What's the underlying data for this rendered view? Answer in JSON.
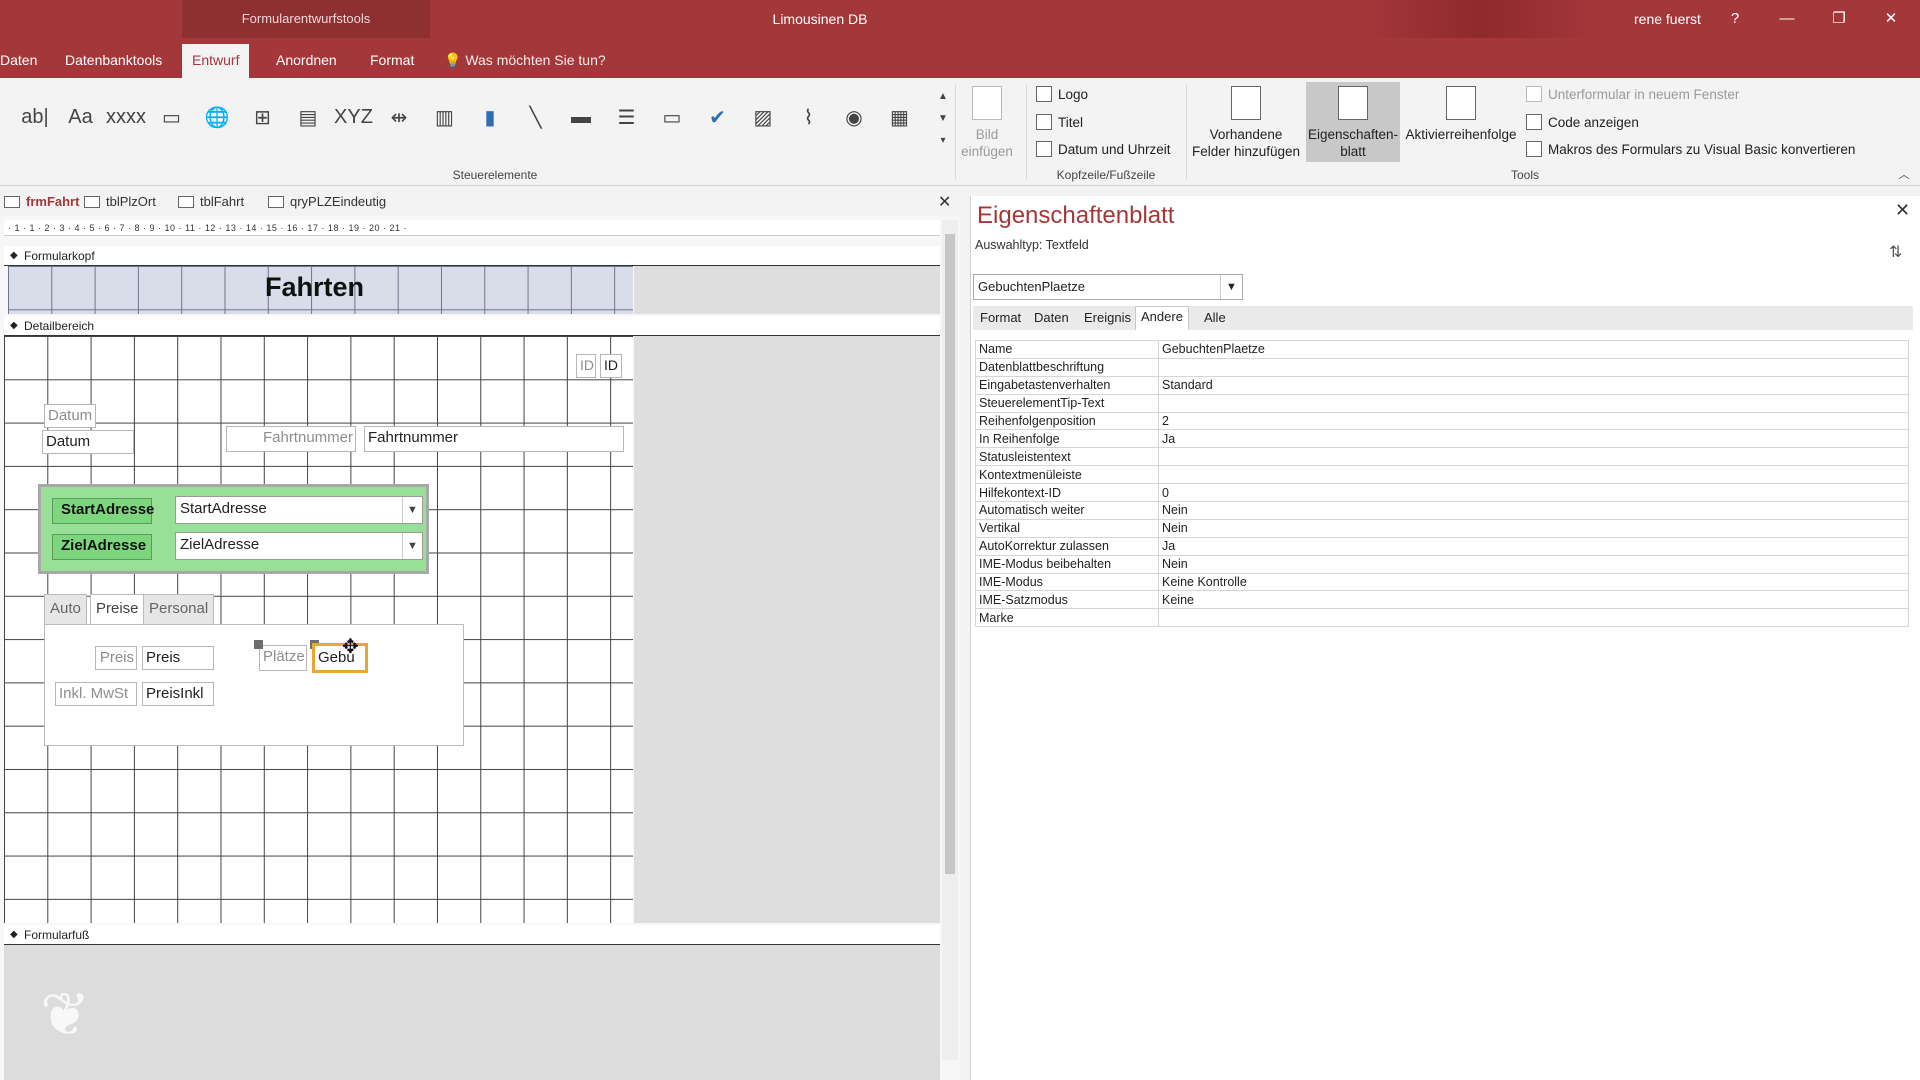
{
  "window": {
    "context_tools": "Formularentwurfstools",
    "title": "Limousinen DB",
    "user": "rene fuerst",
    "help": "?",
    "minimize": "—",
    "restore": "❐",
    "close": "✕"
  },
  "ribbon_tabs": [
    {
      "label": "Daten"
    },
    {
      "label": "Datenbanktools"
    },
    {
      "label": "Entwurf"
    },
    {
      "label": "Anordnen"
    },
    {
      "label": "Format"
    }
  ],
  "tell_me": "Was möchten Sie tun?",
  "ribbon": {
    "controls_label": "Steuerelemente",
    "control_glyphs": [
      "ab|",
      "Aa",
      "xxxx",
      "▭",
      "🌐",
      "⊞",
      "▤",
      "XYZ",
      "⇹",
      "▥",
      "▮",
      "╲",
      "▬",
      "☰",
      "▭",
      "✔",
      "▨",
      "⌇",
      "◉",
      "▦"
    ],
    "insert_image": "Bild einfügen",
    "logo": "Logo",
    "title": "Titel",
    "date_time": "Datum und Uhrzeit",
    "header_footer_label": "Kopfzeile/Fußzeile",
    "add_fields": "Vorhandene Felder hinzufügen",
    "property_sheet": "Eigenschaften-blatt",
    "tab_order": "Aktivierreihenfolge",
    "subform_window": "Unterformular in neuem Fenster",
    "view_code": "Code anzeigen",
    "convert_macros": "Makros des Formulars zu Visual Basic konvertieren",
    "tools_label": "Tools"
  },
  "doc_tabs": [
    {
      "label": "frmFahrt"
    },
    {
      "label": "tblPlzOrt"
    },
    {
      "label": "tblFahrt"
    },
    {
      "label": "qryPLZEindeutig"
    }
  ],
  "ruler_text": "· 1 · 1 · 2 · 3 · 4 · 5 · 6 · 7 · 8 · 9 · 10 · 11 · 12 · 13 · 14 · 15 · 16 · 17 · 18 · 19 · 20 · 21 ·",
  "sections": {
    "header": "Formularkopf",
    "detail": "Detailbereich",
    "footer": "Formularfuß"
  },
  "form": {
    "title": "Fahrten",
    "id_label": "ID",
    "id_field": "ID",
    "datum_label": "Datum",
    "datum_field": "Datum",
    "fahrtnummer_label": "Fahrtnummer",
    "fahrtnummer_field": "Fahrtnummer",
    "start_label": "StartAdresse",
    "start_field": "StartAdresse",
    "ziel_label": "ZielAdresse",
    "ziel_field": "ZielAdresse",
    "tabs": [
      {
        "label": "Auto"
      },
      {
        "label": "Preise"
      },
      {
        "label": "Personal"
      }
    ],
    "preis_label": "Preis",
    "preis_field": "Preis",
    "mwst_label": "Inkl. MwSt",
    "mwst_field": "PreisInkl",
    "plaetze_label": "Plätze",
    "gebu_field": "Gebu"
  },
  "property_sheet": {
    "title": "Eigenschaftenblatt",
    "selection_type": "Auswahltyp:  Textfeld",
    "selected_object": "GebuchtenPlaetze",
    "tabs": [
      {
        "label": "Format"
      },
      {
        "label": "Daten"
      },
      {
        "label": "Ereignis"
      },
      {
        "label": "Andere"
      },
      {
        "label": "Alle"
      }
    ],
    "active_tab": "Andere",
    "rows": [
      {
        "key": "Name",
        "value": "GebuchtenPlaetze"
      },
      {
        "key": "Datenblattbeschriftung",
        "value": ""
      },
      {
        "key": "Eingabetastenverhalten",
        "value": "Standard"
      },
      {
        "key": "SteuerelementTip-Text",
        "value": ""
      },
      {
        "key": "Reihenfolgenposition",
        "value": "2"
      },
      {
        "key": "In Reihenfolge",
        "value": "Ja"
      },
      {
        "key": "Statusleistentext",
        "value": ""
      },
      {
        "key": "Kontextmenüleiste",
        "value": ""
      },
      {
        "key": "Hilfekontext-ID",
        "value": "0"
      },
      {
        "key": "Automatisch weiter",
        "value": "Nein"
      },
      {
        "key": "Vertikal",
        "value": "Nein"
      },
      {
        "key": "AutoKorrektur zulassen",
        "value": "Ja"
      },
      {
        "key": "IME-Modus beibehalten",
        "value": "Nein"
      },
      {
        "key": "IME-Modus",
        "value": "Keine Kontrolle"
      },
      {
        "key": "IME-Satzmodus",
        "value": "Keine"
      },
      {
        "key": "Marke",
        "value": ""
      }
    ]
  },
  "colors": {
    "accent": "#a4373a",
    "green_group": "#98df98",
    "selection": "#e8a735"
  }
}
